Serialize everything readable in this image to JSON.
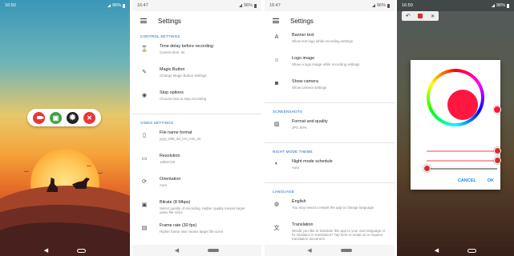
{
  "panel1": {
    "status_time": "16:50",
    "status_battery": "96%",
    "toolbar": [
      {
        "name": "record-button",
        "color": "#e53935",
        "icon": "video-camera-icon"
      },
      {
        "name": "screenshot-button",
        "color": "#43a047",
        "icon": "image-icon"
      },
      {
        "name": "settings-button",
        "color": "#222222",
        "icon": "gear-icon"
      },
      {
        "name": "close-button",
        "color": "#e53935",
        "icon": "close-icon"
      }
    ]
  },
  "panel2": {
    "status_time": "16:47",
    "status_battery": "96%",
    "title": "Settings",
    "sections": [
      {
        "header": "CONTROL SETTINGS",
        "items": [
          {
            "icon": "hourglass-icon",
            "glyph": "⌛",
            "title": "Time delay before recording",
            "subtitle": "Current time: 0s"
          },
          {
            "icon": "magic-wand-icon",
            "glyph": "✎",
            "title": "Magic Button",
            "subtitle": "Change Magic Button settings"
          },
          {
            "icon": "stop-options-icon",
            "glyph": "◉",
            "title": "Stop options",
            "subtitle": "Choose how to stop recording"
          }
        ]
      },
      {
        "header": "VIDEO SETTINGS",
        "items": [
          {
            "icon": "file-icon",
            "glyph": "▯",
            "title": "File name format",
            "subtitle": "yyyy_MM_dd_HH_mm_ss"
          },
          {
            "icon": "resolution-icon",
            "glyph": "▭",
            "title": "Resolution",
            "subtitle": "1280x720"
          },
          {
            "icon": "rotate-icon",
            "glyph": "⟳",
            "title": "Orientation",
            "subtitle": "Auto"
          },
          {
            "icon": "bitrate-icon",
            "glyph": "▣",
            "title": "Bitrate (8 Mbps)",
            "subtitle": "Select quality of recording. Higher quality means larger video file sizes"
          },
          {
            "icon": "frame-rate-icon",
            "glyph": "▤",
            "title": "Frame rate (30 fps)",
            "subtitle": "Higher frame rate means larger file sizes"
          }
        ]
      }
    ]
  },
  "panel3": {
    "status_time": "16:47",
    "status_battery": "96%",
    "title": "Settings",
    "sections": [
      {
        "header": "",
        "items": [
          {
            "icon": "text-icon",
            "glyph": "A",
            "title": "Banner text",
            "subtitle": "Show text logo while recording settings"
          },
          {
            "icon": "logo-icon",
            "glyph": "☺",
            "title": "Logo image",
            "subtitle": "Show a logo image while recording settings"
          },
          {
            "icon": "camera-icon",
            "glyph": "◙",
            "title": "Show camera",
            "subtitle": "Show camera settings"
          }
        ]
      },
      {
        "header": "SCREENSHOTS",
        "items": [
          {
            "icon": "image-icon",
            "glyph": "▨",
            "title": "Format and quality",
            "subtitle": "JPG 90%"
          }
        ]
      },
      {
        "header": "NIGHT MODE THEME",
        "items": [
          {
            "icon": "moon-icon",
            "glyph": "◐",
            "title": "Night mode schedule",
            "subtitle": "Auto"
          }
        ]
      },
      {
        "header": "LANGUAGE",
        "items": [
          {
            "icon": "globe-icon",
            "glyph": "◍",
            "title": "English",
            "subtitle": "You may need to restart the app to change language"
          },
          {
            "icon": "translate-icon",
            "glyph": "文",
            "title": "Translation",
            "subtitle": "Would you like to translate this app to your own language or fix mistakes in translation? Tap here to email us to request translation document"
          }
        ]
      }
    ]
  },
  "panel4": {
    "status_time": "16:50",
    "status_battery": "96%",
    "selected_color": "#ff1740",
    "sliders": [
      {
        "name": "saturation-slider",
        "value": 1.0,
        "track": "#f3a3a3"
      },
      {
        "name": "value-slider",
        "value": 1.0,
        "track": "#f3a3a3"
      },
      {
        "name": "opacity-slider",
        "value": 0.0,
        "track": "#999999"
      }
    ],
    "cancel_label": "CANCEL",
    "ok_label": "OK"
  }
}
